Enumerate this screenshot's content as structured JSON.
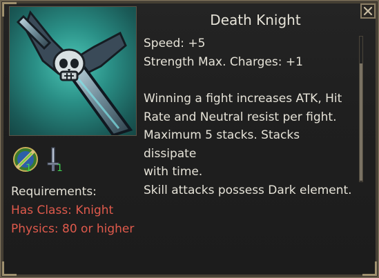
{
  "title": "Death Knight",
  "stats": [
    "Speed: +5",
    "Strength Max. Charges: +1"
  ],
  "description": [
    "Winning a fight increases ATK, Hit",
    "Rate and Neutral resist per fight.",
    "Maximum 5 stacks. Stacks dissipate",
    "with time.",
    "Skill attacks possess Dark element."
  ],
  "bonus_icons": [
    {
      "icon": "class-emblem-icon",
      "count": "1"
    },
    {
      "icon": "sword-icon",
      "count": "1"
    }
  ],
  "requirements": {
    "heading": "Requirements:",
    "items": [
      "Has Class: Knight",
      "Physics: 80 or higher"
    ],
    "color": "#e05a4c"
  },
  "colors": {
    "text": "#e6e3d8",
    "accent_green": "#3fd14f",
    "border": "#6e6350"
  }
}
